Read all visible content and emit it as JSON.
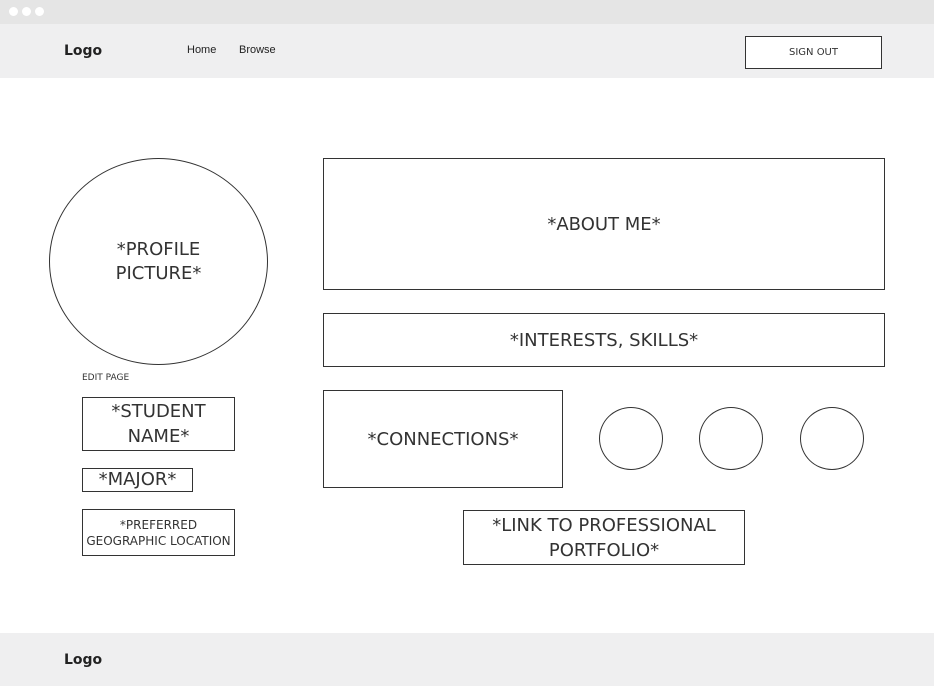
{
  "window": {
    "controls": [
      "dot-1",
      "dot-2",
      "dot-3"
    ]
  },
  "header": {
    "logo": "Logo",
    "nav": {
      "home": "Home",
      "browse": "Browse"
    },
    "sign_out": "SIGN OUT"
  },
  "profile": {
    "picture": "*PROFILE PICTURE*",
    "edit_page": "EDIT PAGE",
    "student_name": "*STUDENT NAME*",
    "major": "*MAJOR*",
    "location": "*PREFERRED GEOGRAPHIC LOCATION"
  },
  "main": {
    "about_me": "*ABOUT ME*",
    "interests": "*INTERESTS, SKILLS*",
    "connections": "*CONNECTIONS*",
    "portfolio_link": "*LINK TO PROFESSIONAL PORTFOLIO*"
  },
  "footer": {
    "logo": "Logo"
  }
}
